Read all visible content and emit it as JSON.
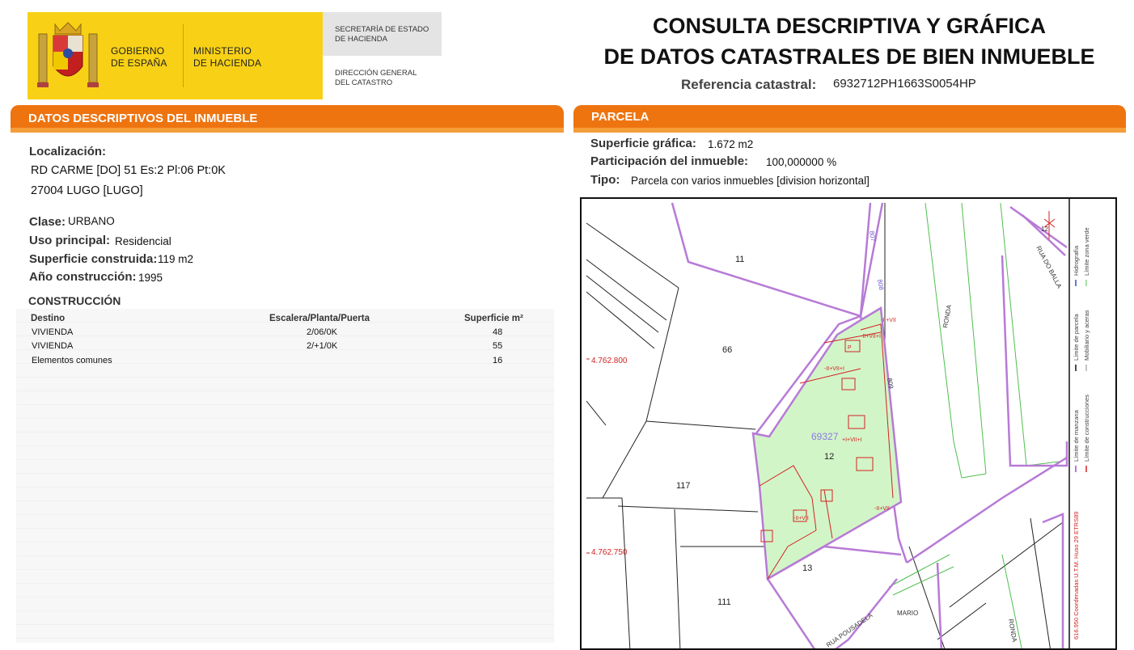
{
  "header": {
    "gobierno": [
      "GOBIERNO",
      "DE ESPAÑA"
    ],
    "ministerio": [
      "MINISTERIO",
      "DE HACIENDA"
    ],
    "secretaria": [
      "SECRETARÍA DE ESTADO",
      "DE HACIENDA"
    ],
    "direccion": [
      "DIRECCIÓN GENERAL",
      "DEL CATASTRO"
    ],
    "title_line1": "CONSULTA DESCRIPTIVA Y GRÁFICA",
    "title_line2": "DE DATOS CATASTRALES DE BIEN INMUEBLE",
    "ref_label": "Referencia catastral:",
    "ref_value": "6932712PH1663S0054HP"
  },
  "descriptivos": {
    "header": "DATOS DESCRIPTIVOS DEL INMUEBLE",
    "localizacion_label": "Localización:",
    "address_line1": "RD CARME [DO] 51 Es:2 Pl:06 Pt:0K",
    "address_line2": "27004 LUGO [LUGO]",
    "clase_label": "Clase:",
    "clase_value": "URBANO",
    "uso_label": "Uso principal:",
    "uso_value": "Residencial",
    "superficie_label": "Superficie construida:",
    "superficie_value": "119 m2",
    "anio_label": "Año construcción:",
    "anio_value": "1995",
    "construccion_title": "CONSTRUCCIÓN",
    "table": {
      "headers": [
        "Destino",
        "Escalera/Planta/Puerta",
        "Superficie m²"
      ],
      "rows": [
        [
          "VIVIENDA",
          "2/06/0K",
          "48"
        ],
        [
          "VIVIENDA",
          "2/+1/0K",
          "55"
        ],
        [
          "Elementos comunes",
          "",
          "16"
        ]
      ]
    }
  },
  "parcela": {
    "header": "PARCELA",
    "superficie_label": "Superficie gráfica:",
    "superficie_value": "1.672 m2",
    "participacion_label": "Participación del inmueble:",
    "participacion_value": "100,000000 %",
    "tipo_label": "Tipo:",
    "tipo_value": "Parcela con varios inmuebles [division horizontal]"
  },
  "map": {
    "parcel_ref": "69327",
    "parcel_numbers": [
      "11",
      "66",
      "12",
      "117",
      "13",
      "111"
    ],
    "coord_labels": [
      "4.762.800",
      "4.762.750"
    ],
    "building_labels": [
      "-II+VII",
      "-II+VII+I",
      "-II+VII+I",
      "+I+VII+I",
      "-II+VII",
      "-II+VII",
      "P"
    ],
    "street_labels": [
      "RONDA",
      "RUA DO BALLA",
      "RUA POUSADELA",
      "MARIO",
      "RONDA"
    ],
    "road_numbers": [
      "807",
      "808",
      "809",
      "12"
    ],
    "legend_left": [
      "Límite de manzana",
      "Límite de parcela",
      "Hidrografía"
    ],
    "legend_right": [
      "Límite de construcciones",
      "Mobiliario y aceras",
      "Límite zona verde"
    ],
    "coords_note": "616.950 Coordenadas U.T.M. Huso 29 ETRS89"
  },
  "colors": {
    "logo_yellow": "#f8d116",
    "header_orange": "#ee7410",
    "parcel_green": "#d2f5c8",
    "boundary_purple": "#b77ad6",
    "building_red": "#d22222"
  }
}
